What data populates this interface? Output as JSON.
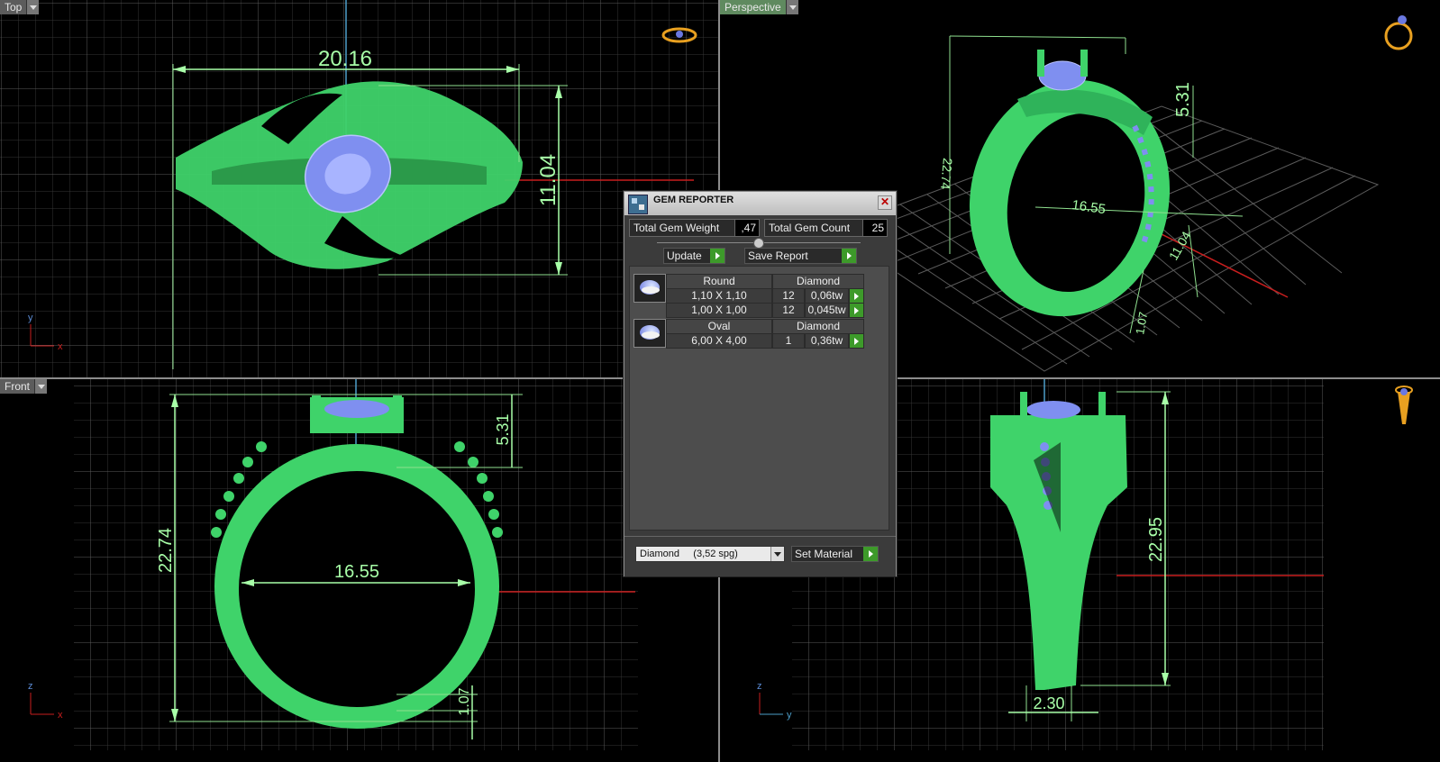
{
  "viewports": {
    "top": {
      "label": "Top",
      "axis_a": "y",
      "axis_b": "x",
      "dims": [
        "20.16",
        "11.04"
      ]
    },
    "perspective": {
      "label": "Perspective",
      "dims": [
        "22.74",
        "5.31",
        "16.55",
        "11.04",
        "1.07"
      ]
    },
    "front": {
      "label": "Front",
      "axis_a": "z",
      "axis_b": "x",
      "dims": [
        "22.74",
        "16.55",
        "5.31",
        "1.07"
      ]
    },
    "right": {
      "axis_a": "z",
      "axis_b": "y",
      "dims": [
        "22.95",
        "2.30"
      ]
    }
  },
  "gem_reporter": {
    "title": "GEM REPORTER",
    "total_weight_label": "Total Gem Weight",
    "total_weight": ",47",
    "total_count_label": "Total Gem Count",
    "total_count": "25",
    "update_label": "Update",
    "save_label": "Save Report",
    "groups": [
      {
        "shape": "Round",
        "material": "Diamond",
        "rows": [
          {
            "size": "1,10 X 1,10",
            "count": "12",
            "weight": "0,06tw"
          },
          {
            "size": "1,00 X 1,00",
            "count": "12",
            "weight": "0,045tw"
          }
        ]
      },
      {
        "shape": "Oval",
        "material": "Diamond",
        "rows": [
          {
            "size": "6,00 X 4,00",
            "count": "1",
            "weight": "0,36tw"
          }
        ]
      }
    ],
    "material_select": "Diamond     (3,52 spg)",
    "set_material_label": "Set Material"
  },
  "colors": {
    "model": "#3fd36a",
    "gem": "#7f8ff0",
    "dim": "#a8ffa8",
    "grid": "#3a3a3a",
    "axis_red": "#c81e1e"
  }
}
